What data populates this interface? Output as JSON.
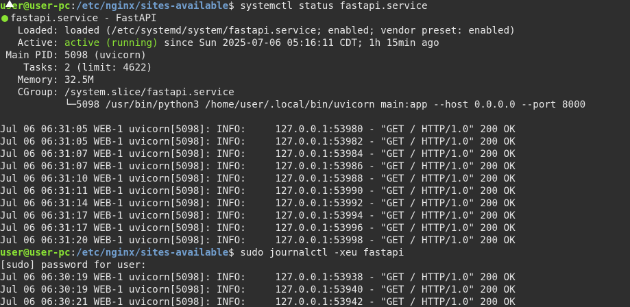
{
  "prompt1": {
    "userhost": "user@user-pc",
    "sep": ":",
    "path": "/etc/nginx/sites-available",
    "dollar": "$",
    "command": " systemctl status fastapi.service"
  },
  "status": {
    "title": "fastapi.service - FastAPI",
    "loaded": "   Loaded: loaded (/etc/systemd/system/fastapi.service; enabled; vendor preset: enabled)",
    "active_label": "   Active: ",
    "active_state": "active (running)",
    "active_rest": " since Sun 2025-07-06 05:16:11 CDT; 1h 15min ago",
    "main_pid": " Main PID: 5098 (uvicorn)",
    "tasks": "    Tasks: 2 (limit: 4622)",
    "memory": "   Memory: 32.5M",
    "cgroup": "   CGroup: /system.slice/fastapi.service",
    "cgroup_child": "           └─5098 /usr/bin/python3 /home/user/.local/bin/uvicorn main:app --host 0.0.0.0 --port 8000"
  },
  "log1": [
    "Jul 06 06:31:05 WEB-1 uvicorn[5098]: INFO:     127.0.0.1:53980 - \"GET / HTTP/1.0\" 200 OK",
    "Jul 06 06:31:05 WEB-1 uvicorn[5098]: INFO:     127.0.0.1:53982 - \"GET / HTTP/1.0\" 200 OK",
    "Jul 06 06:31:07 WEB-1 uvicorn[5098]: INFO:     127.0.0.1:53984 - \"GET / HTTP/1.0\" 200 OK",
    "Jul 06 06:31:07 WEB-1 uvicorn[5098]: INFO:     127.0.0.1:53986 - \"GET / HTTP/1.0\" 200 OK",
    "Jul 06 06:31:10 WEB-1 uvicorn[5098]: INFO:     127.0.0.1:53988 - \"GET / HTTP/1.0\" 200 OK",
    "Jul 06 06:31:11 WEB-1 uvicorn[5098]: INFO:     127.0.0.1:53990 - \"GET / HTTP/1.0\" 200 OK",
    "Jul 06 06:31:14 WEB-1 uvicorn[5098]: INFO:     127.0.0.1:53992 - \"GET / HTTP/1.0\" 200 OK",
    "Jul 06 06:31:17 WEB-1 uvicorn[5098]: INFO:     127.0.0.1:53994 - \"GET / HTTP/1.0\" 200 OK",
    "Jul 06 06:31:17 WEB-1 uvicorn[5098]: INFO:     127.0.0.1:53996 - \"GET / HTTP/1.0\" 200 OK",
    "Jul 06 06:31:20 WEB-1 uvicorn[5098]: INFO:     127.0.0.1:53998 - \"GET / HTTP/1.0\" 200 OK"
  ],
  "prompt2": {
    "userhost": "user@user-pc",
    "sep": ":",
    "path": "/etc/nginx/sites-available",
    "dollar": "$",
    "command": " sudo journalctl -xeu fastapi"
  },
  "sudo_prompt": "[sudo] password for user:",
  "log2": [
    "Jul 06 06:30:19 WEB-1 uvicorn[5098]: INFO:     127.0.0.1:53938 - \"GET / HTTP/1.0\" 200 OK",
    "Jul 06 06:30:19 WEB-1 uvicorn[5098]: INFO:     127.0.0.1:53940 - \"GET / HTTP/1.0\" 200 OK",
    "Jul 06 06:30:21 WEB-1 uvicorn[5098]: INFO:     127.0.0.1:53942 - \"GET / HTTP/1.0\" 200 OK"
  ],
  "colors": {
    "background": "#2e2e2e",
    "prompt_user": "#8ae234",
    "prompt_path": "#729fcf",
    "text": "#e6e6e6"
  }
}
